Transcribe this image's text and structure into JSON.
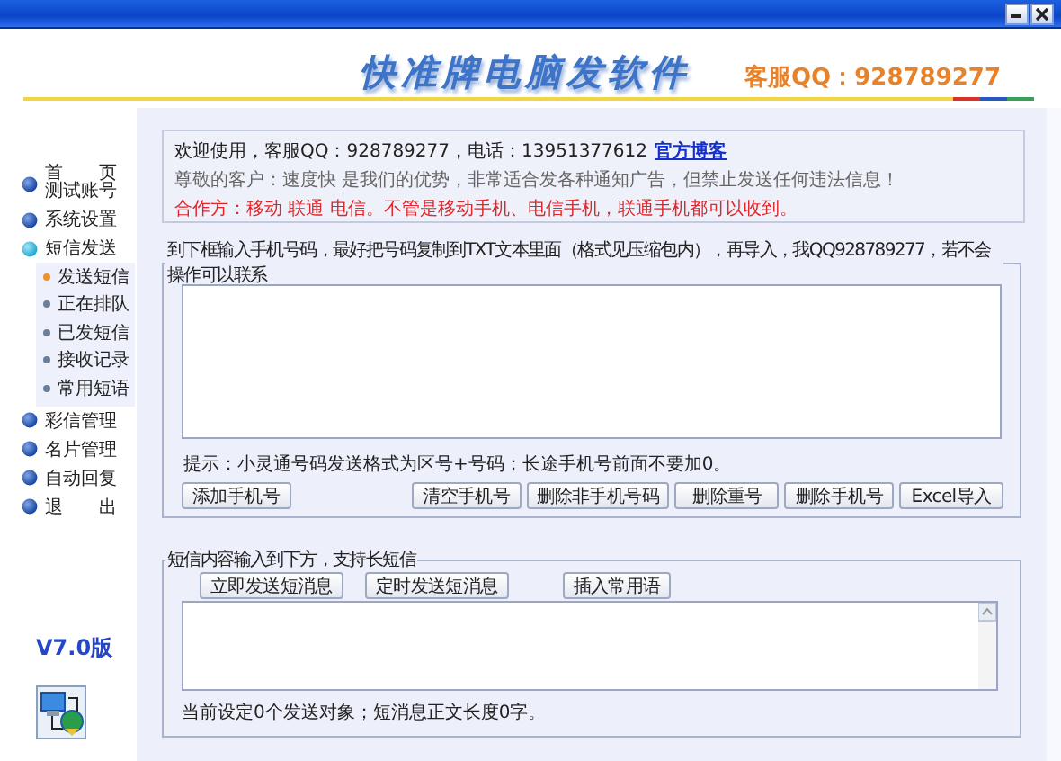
{
  "header": {
    "logo": "快准牌电脑发软件",
    "service_qq": "客服QQ：928789277"
  },
  "sidebar": {
    "items": [
      {
        "label": "首　　页",
        "sublabel": "测试账号",
        "expanded": false
      },
      {
        "label": "系统设置",
        "expanded": false
      },
      {
        "label": "短信发送",
        "expanded": true,
        "children": [
          {
            "label": "发送短信",
            "selected": true
          },
          {
            "label": "正在排队",
            "selected": false
          },
          {
            "label": "已发短信",
            "selected": false
          },
          {
            "label": "接收记录",
            "selected": false
          },
          {
            "label": "常用短语",
            "selected": false
          }
        ]
      },
      {
        "label": "彩信管理",
        "expanded": false
      },
      {
        "label": "名片管理",
        "expanded": false
      },
      {
        "label": "自动回复",
        "expanded": false
      },
      {
        "label": "退　　出",
        "expanded": false
      }
    ],
    "version": "V7.0版"
  },
  "notice": {
    "welcome": "欢迎使用，客服QQ：928789277，电话：13951377612",
    "link": "官方博客",
    "customers": "尊敬的客户：速度快 是我们的优势，非常适合发各种通知广告，但禁止发送任何违法信息！",
    "partners": "合作方：移动 联通 电信。不管是移动手机、电信手机，联通手机都可以收到。"
  },
  "number_panel": {
    "legend": "到下框输入手机号码，最好把号码复制到TXT文本里面（格式见压缩包内），再导入，我QQ928789277，若不会操作可以联系",
    "hint": "提示：小灵通号码发送格式为区号+号码；长途手机号前面不要加0。",
    "buttons": [
      "添加手机号",
      "清空手机号",
      "删除非手机号码",
      "删除重号",
      "删除手机号",
      "Excel导入"
    ]
  },
  "message_panel": {
    "legend": "短信内容输入到下方，支持长短信",
    "buttons": [
      "立即发送短消息",
      "定时发送短消息",
      "插入常用语"
    ],
    "status": "当前设定0个发送对象；短消息正文长度0字。"
  }
}
